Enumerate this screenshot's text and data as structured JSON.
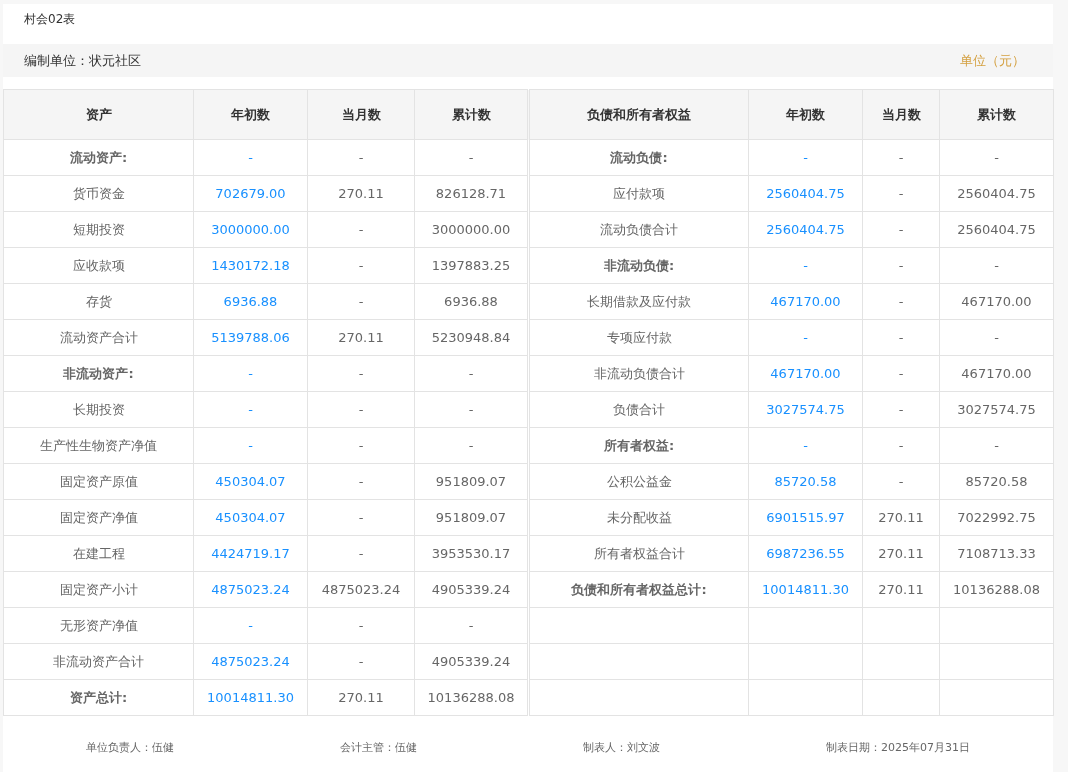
{
  "title": "村会02表",
  "info": {
    "unit_name": "编制单位：状元社区",
    "currency": "单位（元）"
  },
  "columns_left": [
    "资产",
    "年初数",
    "当月数",
    "累计数"
  ],
  "columns_right": [
    "负债和所有者权益",
    "年初数",
    "当月数",
    "累计数"
  ],
  "assets": [
    {
      "kind": "heading",
      "label": "流动资产:",
      "begin": "-",
      "month": "-",
      "total": "-"
    },
    {
      "kind": "item",
      "label": "货币资金",
      "begin": "702679.00",
      "month": "270.11",
      "total": "826128.71"
    },
    {
      "kind": "item",
      "label": "短期投资",
      "begin": "3000000.00",
      "month": "-",
      "total": "3000000.00"
    },
    {
      "kind": "item",
      "label": "应收款项",
      "begin": "1430172.18",
      "month": "-",
      "total": "1397883.25"
    },
    {
      "kind": "item",
      "label": "存货",
      "begin": "6936.88",
      "month": "-",
      "total": "6936.88"
    },
    {
      "kind": "item",
      "label": "流动资产合计",
      "begin": "5139788.06",
      "month": "270.11",
      "total": "5230948.84"
    },
    {
      "kind": "heading",
      "label": "非流动资产:",
      "begin": "-",
      "month": "-",
      "total": "-"
    },
    {
      "kind": "item",
      "label": "长期投资",
      "begin": "-",
      "month": "-",
      "total": "-"
    },
    {
      "kind": "item",
      "label": "生产性生物资产净值",
      "begin": "-",
      "month": "-",
      "total": "-"
    },
    {
      "kind": "item",
      "label": "固定资产原值",
      "begin": "450304.07",
      "month": "-",
      "total": "951809.07"
    },
    {
      "kind": "item",
      "label": "固定资产净值",
      "begin": "450304.07",
      "month": "-",
      "total": "951809.07"
    },
    {
      "kind": "item",
      "label": "在建工程",
      "begin": "4424719.17",
      "month": "-",
      "total": "3953530.17"
    },
    {
      "kind": "item",
      "label": "固定资产小计",
      "begin": "4875023.24",
      "month": "4875023.24",
      "total": "4905339.24"
    },
    {
      "kind": "item",
      "label": "无形资产净值",
      "begin": "-",
      "month": "-",
      "total": "-"
    },
    {
      "kind": "item",
      "label": "非流动资产合计",
      "begin": "4875023.24",
      "month": "-",
      "total": "4905339.24"
    },
    {
      "kind": "heading",
      "label": "资产总计:",
      "begin": "10014811.30",
      "month": "270.11",
      "total": "10136288.08"
    }
  ],
  "liabilities": [
    {
      "kind": "heading",
      "label": "流动负债:",
      "begin": "-",
      "month": "-",
      "total": "-"
    },
    {
      "kind": "item",
      "label": "应付款项",
      "begin": "2560404.75",
      "month": "-",
      "total": "2560404.75"
    },
    {
      "kind": "item",
      "label": "流动负债合计",
      "begin": "2560404.75",
      "month": "-",
      "total": "2560404.75"
    },
    {
      "kind": "heading",
      "label": "非流动负债:",
      "begin": "-",
      "month": "-",
      "total": "-"
    },
    {
      "kind": "item",
      "label": "长期借款及应付款",
      "begin": "467170.00",
      "month": "-",
      "total": "467170.00"
    },
    {
      "kind": "item",
      "label": "专项应付款",
      "begin": "-",
      "month": "-",
      "total": "-"
    },
    {
      "kind": "item",
      "label": "非流动负债合计",
      "begin": "467170.00",
      "month": "-",
      "total": "467170.00"
    },
    {
      "kind": "item",
      "label": "负债合计",
      "begin": "3027574.75",
      "month": "-",
      "total": "3027574.75"
    },
    {
      "kind": "heading",
      "label": "所有者权益:",
      "begin": "-",
      "month": "-",
      "total": "-"
    },
    {
      "kind": "item",
      "label": "公积公益金",
      "begin": "85720.58",
      "month": "-",
      "total": "85720.58"
    },
    {
      "kind": "item",
      "label": "未分配收益",
      "begin": "6901515.97",
      "month": "270.11",
      "total": "7022992.75"
    },
    {
      "kind": "item",
      "label": "所有者权益合计",
      "begin": "6987236.55",
      "month": "270.11",
      "total": "7108713.33"
    },
    {
      "kind": "heading",
      "label": "负债和所有者权益总计:",
      "begin": "10014811.30",
      "month": "270.11",
      "total": "10136288.08"
    }
  ],
  "footer": [
    "单位负责人：伍健",
    "会计主管：伍健",
    "制表人：刘文波",
    "制表日期：2025年07月31日"
  ]
}
